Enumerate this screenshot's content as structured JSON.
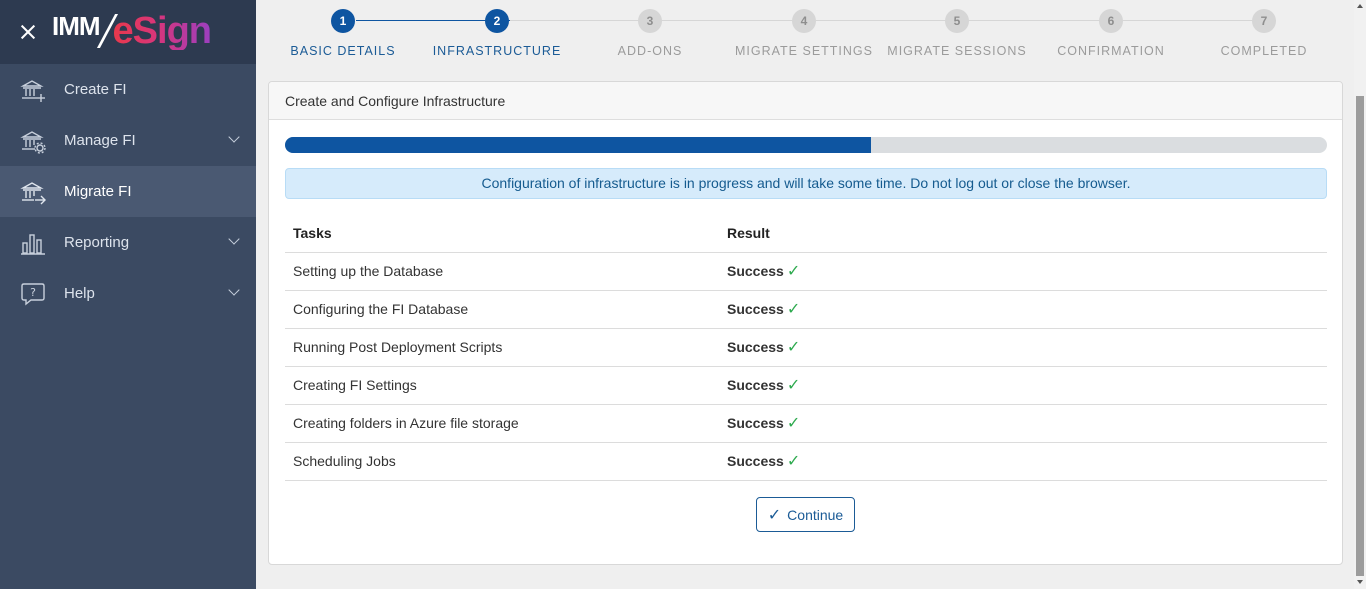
{
  "brand": {
    "part1": "IMM",
    "part2": "eSign",
    "close_icon": "close-icon"
  },
  "sidebar": {
    "items": [
      {
        "label": "Create FI",
        "icon": "bank-plus-icon",
        "expandable": false,
        "active": false
      },
      {
        "label": "Manage FI",
        "icon": "bank-gear-icon",
        "expandable": true,
        "active": false
      },
      {
        "label": "Migrate FI",
        "icon": "bank-arrow-icon",
        "expandable": false,
        "active": true
      },
      {
        "label": "Reporting",
        "icon": "bar-chart-icon",
        "expandable": true,
        "active": false
      },
      {
        "label": "Help",
        "icon": "help-bubble-icon",
        "expandable": true,
        "active": false
      }
    ]
  },
  "stepper": {
    "steps": [
      {
        "num": "1",
        "label": "BASIC DETAILS",
        "state": "done"
      },
      {
        "num": "2",
        "label": "INFRASTRUCTURE",
        "state": "done"
      },
      {
        "num": "3",
        "label": "ADD-ONS",
        "state": "todo"
      },
      {
        "num": "4",
        "label": "MIGRATE SETTINGS",
        "state": "todo"
      },
      {
        "num": "5",
        "label": "MIGRATE SESSIONS",
        "state": "todo"
      },
      {
        "num": "6",
        "label": "CONFIRMATION",
        "state": "todo"
      },
      {
        "num": "7",
        "label": "COMPLETED",
        "state": "todo"
      }
    ]
  },
  "card": {
    "title": "Create and Configure Infrastructure",
    "progress_fraction": 0.562,
    "info_message": "Configuration of infrastructure is in progress and will take some time. Do not log out or close the browser.",
    "table": {
      "headers": {
        "task": "Tasks",
        "result": "Result"
      },
      "rows": [
        {
          "task": "Setting up the Database",
          "result": "Success"
        },
        {
          "task": "Configuring the FI Database",
          "result": "Success"
        },
        {
          "task": "Running Post Deployment Scripts",
          "result": "Success"
        },
        {
          "task": "Creating FI Settings",
          "result": "Success"
        },
        {
          "task": "Creating folders in Azure file storage",
          "result": "Success"
        },
        {
          "task": "Scheduling Jobs",
          "result": "Success"
        }
      ]
    },
    "continue_label": "Continue"
  },
  "colors": {
    "primary": "#0e55a1",
    "success": "#2eaa4f",
    "sidebar": "#3b4a62",
    "info_bg": "#d6ebfb"
  }
}
